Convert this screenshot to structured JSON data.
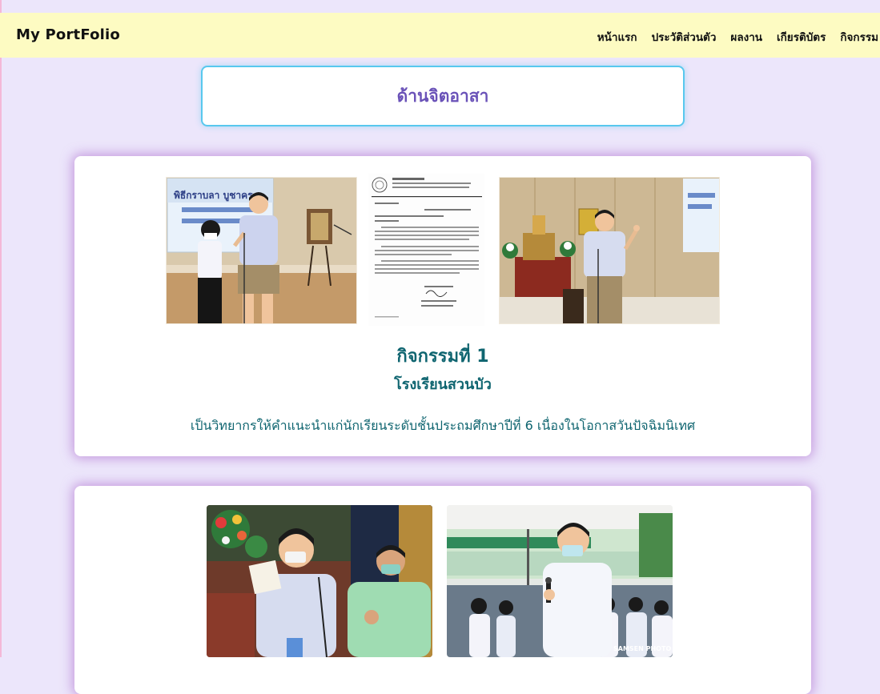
{
  "brand": "My PortFolio",
  "nav": [
    "หน้าแรก",
    "ประวัติส่วนตัว",
    "ผลงาน",
    "เกียรติบัตร",
    "กิจกรรม"
  ],
  "section_title": "ด้านจิตอาสา",
  "activities": [
    {
      "title": "กิจกรรมที่ 1",
      "school": "โรงเรียนสวนบัว",
      "description": "เป็นวิทยากรให้คำแนะนำแก่นักเรียนระดับชั้นประถมศึกษาปีที่ 6 เนื่องในโอกาสวันปัจฉิมนิเทศ",
      "photos": [
        "photo-speaker-with-student",
        "photo-official-letter",
        "photo-speaker-at-podium"
      ],
      "photo_text": {
        "banner": "พิธีกราบลา บูชาคร"
      }
    },
    {
      "photos": [
        "photo-students-reading",
        "photo-speaker-outdoor"
      ],
      "photo_text": {
        "watermark": "SAMSEN PHOTO"
      }
    }
  ]
}
